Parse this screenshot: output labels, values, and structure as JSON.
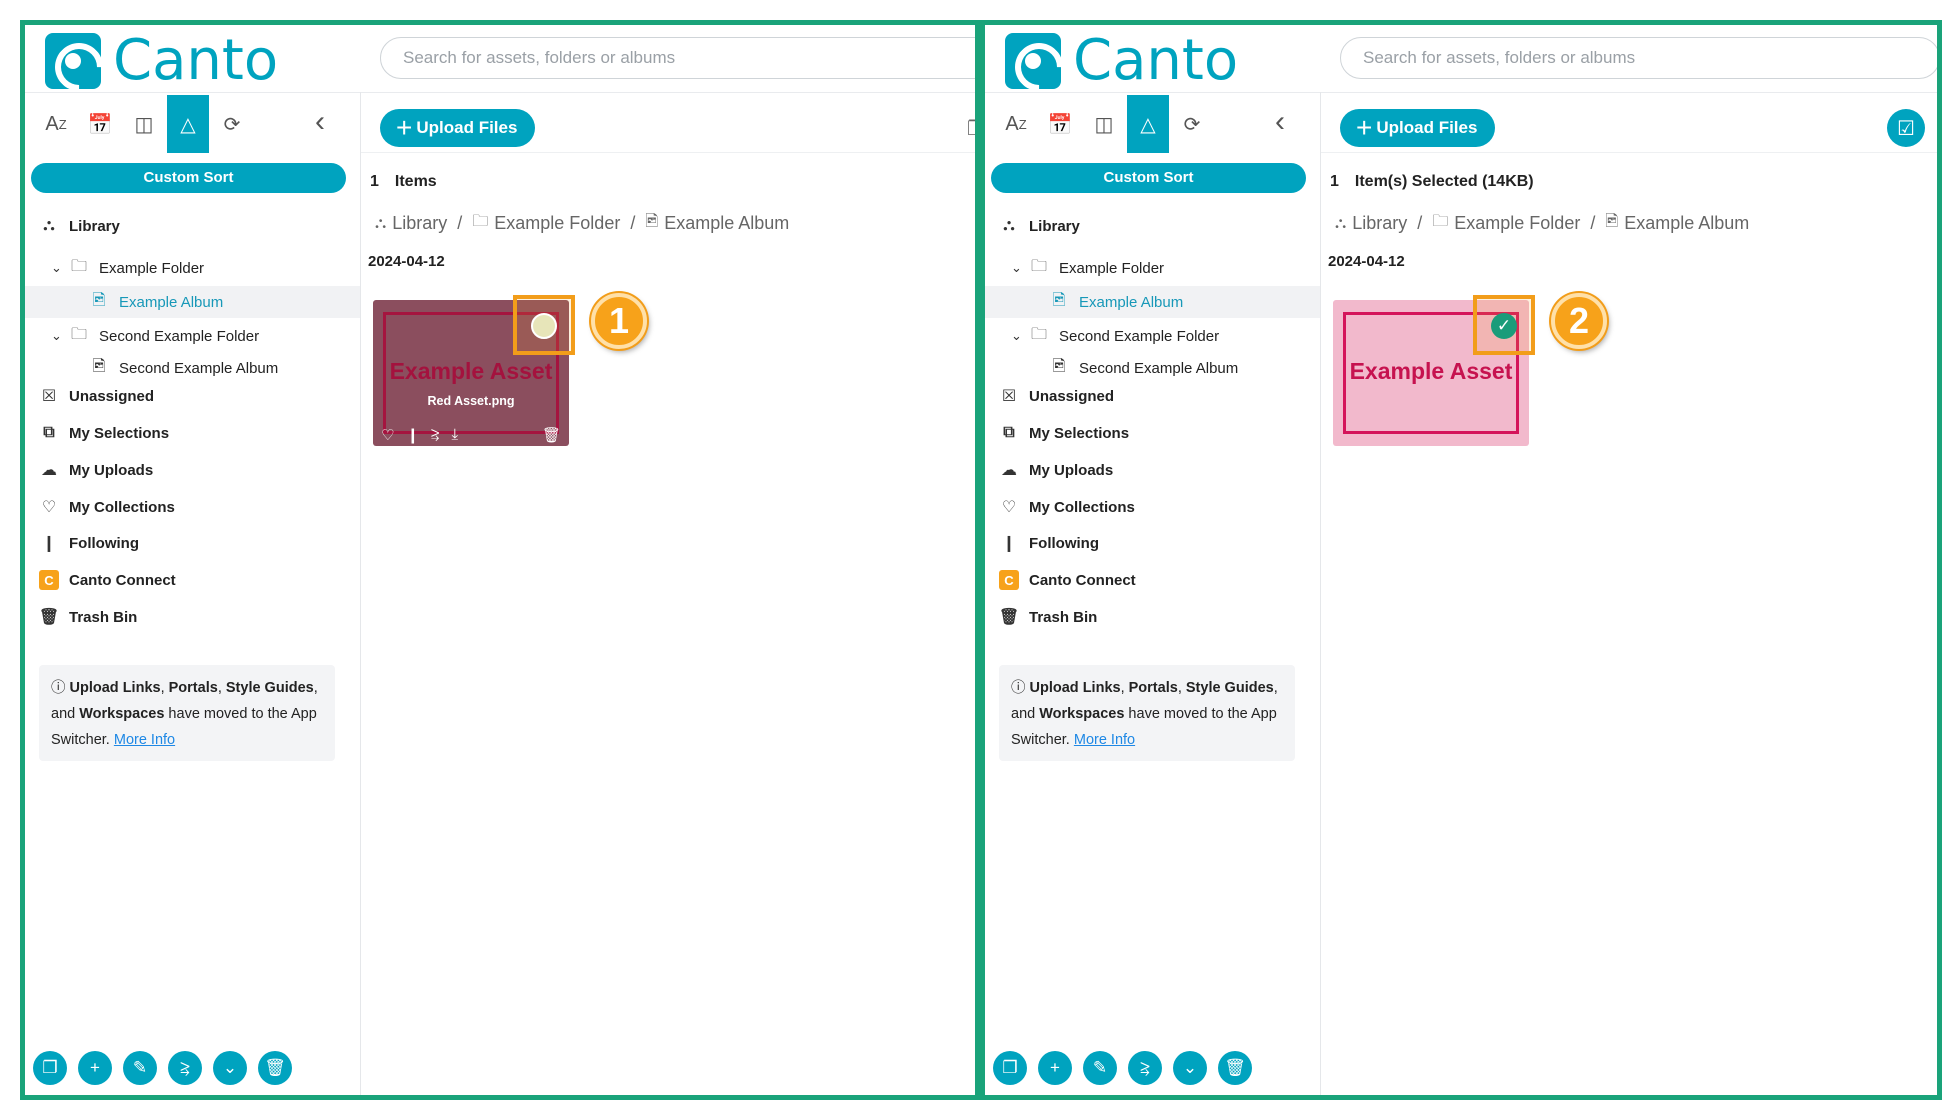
{
  "app": {
    "brand": "Canto",
    "search_placeholder": "Search for assets, folders or albums"
  },
  "sidebar": {
    "sort_icons": [
      "AZ",
      "calendar",
      "columns",
      "shapes",
      "refresh"
    ],
    "custom_sort_label": "Custom Sort",
    "tree": [
      {
        "label": "Library",
        "icon": "library-icon",
        "level": 0,
        "bold": true
      },
      {
        "label": "Example Folder",
        "icon": "folder-icon",
        "level": 1,
        "chevron": true
      },
      {
        "label": "Example Album",
        "icon": "album-icon",
        "level": 2,
        "selected": true
      },
      {
        "label": "Second Example Folder",
        "icon": "folder-icon",
        "level": 1,
        "chevron": true
      },
      {
        "label": "Second Example Album",
        "icon": "album-icon",
        "level": 2
      },
      {
        "label": "Unassigned",
        "icon": "unassigned-icon",
        "level": 0,
        "bold": true
      },
      {
        "label": "My Selections",
        "icon": "selections-icon",
        "level": 0,
        "bold": true
      },
      {
        "label": "My Uploads",
        "icon": "upload-cloud-icon",
        "level": 0,
        "bold": true
      },
      {
        "label": "My Collections",
        "icon": "heart-icon",
        "level": 0,
        "bold": true
      },
      {
        "label": "Following",
        "icon": "bookmark-icon",
        "level": 0,
        "bold": true
      },
      {
        "label": "Canto Connect",
        "icon": "canto-connect-icon",
        "level": 0,
        "bold": true
      },
      {
        "label": "Trash Bin",
        "icon": "trash-icon",
        "level": 0,
        "bold": true
      }
    ],
    "info": {
      "b1": "Upload Links",
      "sep1": ", ",
      "b2": "Portals",
      "sep2": ", ",
      "b3": "Style Guides",
      "mid": ", and ",
      "b4": "Workspaces",
      "tail": " have moved to the App Switcher. ",
      "link": "More Info"
    }
  },
  "main": {
    "upload_label": "Upload Files",
    "date": "2024-04-12",
    "breadcrumb": [
      "Library",
      "Example Folder",
      "Example Album"
    ],
    "asset_title": "Example Asset",
    "asset_filename": "Red Asset.png"
  },
  "panels": [
    {
      "count": "1",
      "count_label": "Items",
      "callout": "1",
      "state": "unselected"
    },
    {
      "count": "1",
      "count_label": "Item(s) Selected (14KB)",
      "callout": "2",
      "state": "selected"
    }
  ],
  "colors": {
    "accent": "#00a3bf",
    "frame": "#1aa37a",
    "highlight": "#f29d1a",
    "asset_pink": "#f2b9cc",
    "asset_red": "#d4145a"
  }
}
